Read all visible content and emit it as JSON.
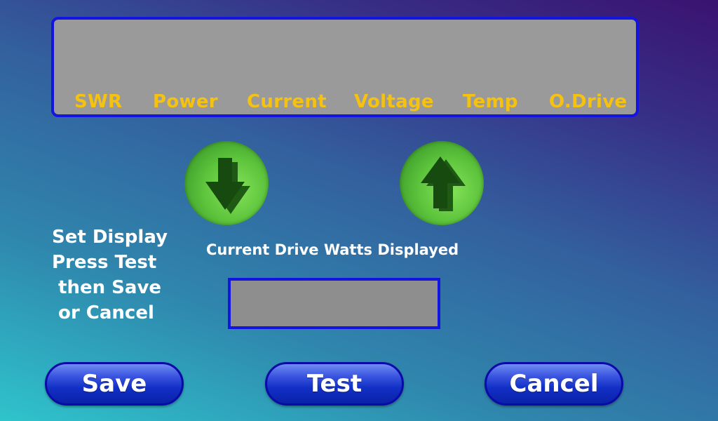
{
  "meter": {
    "labels": [
      "SWR",
      "Power",
      "Current",
      "Voltage",
      "Temp",
      "O.Drive"
    ]
  },
  "arrows": {
    "down_icon": "arrow-down-icon",
    "up_icon": "arrow-up-icon"
  },
  "instructions": {
    "text": "Set Display\nPress Test\n then Save\n or Cancel"
  },
  "drive": {
    "caption": "Current Drive Watts Displayed",
    "value": ""
  },
  "buttons": {
    "save": "Save",
    "test": "Test",
    "cancel": "Cancel"
  },
  "colors": {
    "label_yellow": "#f5c211",
    "panel_border": "#1414e0",
    "button_blue": "#1230c6",
    "arrow_green": "#5dc43c"
  }
}
